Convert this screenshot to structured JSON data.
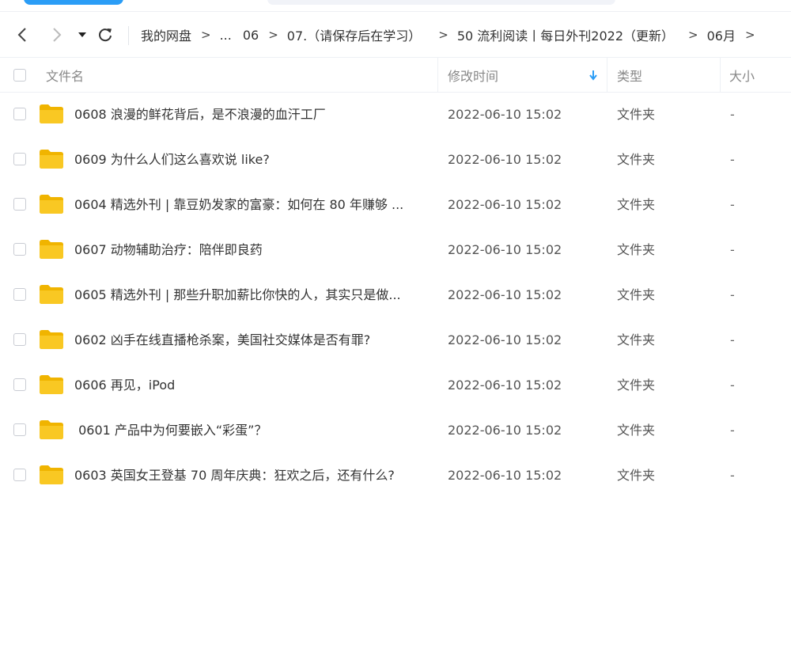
{
  "breadcrumb": {
    "items": [
      "我的网盘",
      "...",
      "06",
      "07.（请保存后在学习）",
      "50 流利阅读丨每日外刊2022（更新）",
      "06月"
    ],
    "separator": ">"
  },
  "table": {
    "headers": {
      "name": "文件名",
      "modified": "修改时间",
      "type": "类型",
      "size": "大小"
    },
    "rows": [
      {
        "name": "0608 浪漫的鲜花背后，是不浪漫的血汗工厂",
        "modified": "2022-06-10 15:02",
        "type": "文件夹",
        "size": "-"
      },
      {
        "name": "0609 为什么人们这么喜欢说 like?",
        "modified": "2022-06-10 15:02",
        "type": "文件夹",
        "size": "-"
      },
      {
        "name": "0604 精选外刊 | 靠豆奶发家的富豪：如何在 80 年赚够 ...",
        "modified": "2022-06-10 15:02",
        "type": "文件夹",
        "size": "-"
      },
      {
        "name": "0607 动物辅助治疗：陪伴即良药",
        "modified": "2022-06-10 15:02",
        "type": "文件夹",
        "size": "-"
      },
      {
        "name": "0605 精选外刊 | 那些升职加薪比你快的人，其实只是做...",
        "modified": "2022-06-10 15:02",
        "type": "文件夹",
        "size": "-"
      },
      {
        "name": "0602 凶手在线直播枪杀案，美国社交媒体是否有罪?",
        "modified": "2022-06-10 15:02",
        "type": "文件夹",
        "size": "-"
      },
      {
        "name": "0606 再见，iPod",
        "modified": "2022-06-10 15:02",
        "type": "文件夹",
        "size": "-"
      },
      {
        "name": " 0601 产品中为何要嵌入“彩蛋”？",
        "modified": "2022-06-10 15:02",
        "type": "文件夹",
        "size": "-"
      },
      {
        "name": "0603 英国女王登基 70 周年庆典：狂欢之后，还有什么?",
        "modified": "2022-06-10 15:02",
        "type": "文件夹",
        "size": "-"
      }
    ]
  },
  "icons": {
    "back": "chevron-left-icon",
    "forward": "chevron-right-icon",
    "dropdown": "caret-down-icon",
    "refresh": "refresh-icon",
    "sort": "sort-desc-arrow-icon",
    "folder": "folder-icon"
  },
  "colors": {
    "accent": "#2b9df6",
    "folder": "#f9c823",
    "folder_back": "#f0b400"
  }
}
